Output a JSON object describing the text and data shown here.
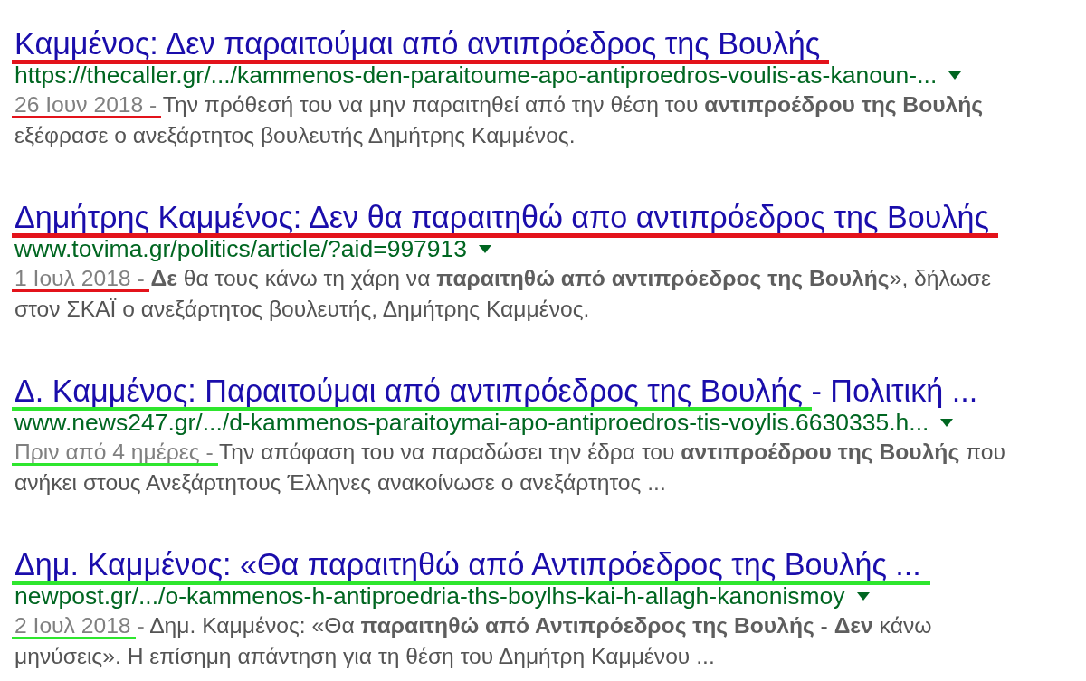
{
  "results": [
    {
      "color": "#e3131b",
      "title": [
        {
          "text": "Καμμένος: Δεν παραιτούμαι από αντιπρόεδρος της Βουλής",
          "underlined": true
        }
      ],
      "url": "https://thecaller.gr/.../kammenos-den-paraitoume-apo-antiproedros-voulis-as-kanoun-...",
      "date": [
        {
          "text": "26 Ιουν 2018 -",
          "underlined": true
        }
      ],
      "snippet": "Την πρόθεσή του να μην παραιτηθεί από την θέση του **αντιπροέδρου της Βουλής** εξέφρασε ο ανεξάρτητος βουλευτής Δημήτρης Καμμένος."
    },
    {
      "color": "#e3131b",
      "title": [
        {
          "text": "Δημήτρης Καμμένος: Δεν θα παραιτηθώ απο αντιπρόεδρος της Βουλής",
          "underlined": true
        }
      ],
      "url": "www.tovima.gr/politics/article/?aid=997913",
      "date": [
        {
          "text": "1 Ιουλ 2018 -",
          "underlined": true
        }
      ],
      "snippet": "**Δε** θα τους κάνω τη χάρη να **παραιτηθώ από αντιπρόεδρος της Βουλής**», δήλωσε στον ΣΚΑΪ ο ανεξάρτητος βουλευτής, Δημήτρης Καμμένος."
    },
    {
      "color": "#2ee62e",
      "title": [
        {
          "text": "Δ. Καμμένος: Παραιτούμαι από αντιπρόεδρος της Βουλής",
          "underlined": true
        },
        {
          "text": "- Πολιτική ...",
          "underlined": false
        }
      ],
      "url": "www.news247.gr/.../d-kammenos-paraitoymai-apo-antiproedros-tis-voylis.6630335.h...",
      "date": [
        {
          "text": "Πριν από 4 ημέρες -",
          "underlined": true
        }
      ],
      "snippet": "Την απόφαση του να παραδώσει την έδρα του **αντιπροέδρου της Βουλής** που ανήκει στους Ανεξάρτητους Έλληνες ανακοίνωσε ο ανεξάρτητος ..."
    },
    {
      "color": "#2ee62e",
      "title": [
        {
          "text": "Δημ. Καμμένος: «Θα παραιτηθώ από Αντιπρόεδρος της Βουλής ...",
          "underlined": true
        }
      ],
      "url": "newpost.gr/.../o-kammenos-h-antiproedria-ths-boylhs-kai-h-allagh-kanonismoy",
      "date": [
        {
          "text": "2 Ιουλ 2018",
          "underlined": true
        },
        {
          "text": "-",
          "underlined": false
        }
      ],
      "snippet": "Δημ. Καμμένος: «Θα **παραιτηθώ από Αντιπρόεδρος της Βουλής** - **Δεν** κάνω μηνύσεις». Η επίσημη απάντηση για τη θέση του Δημήτρη Καμμένου ..."
    }
  ]
}
